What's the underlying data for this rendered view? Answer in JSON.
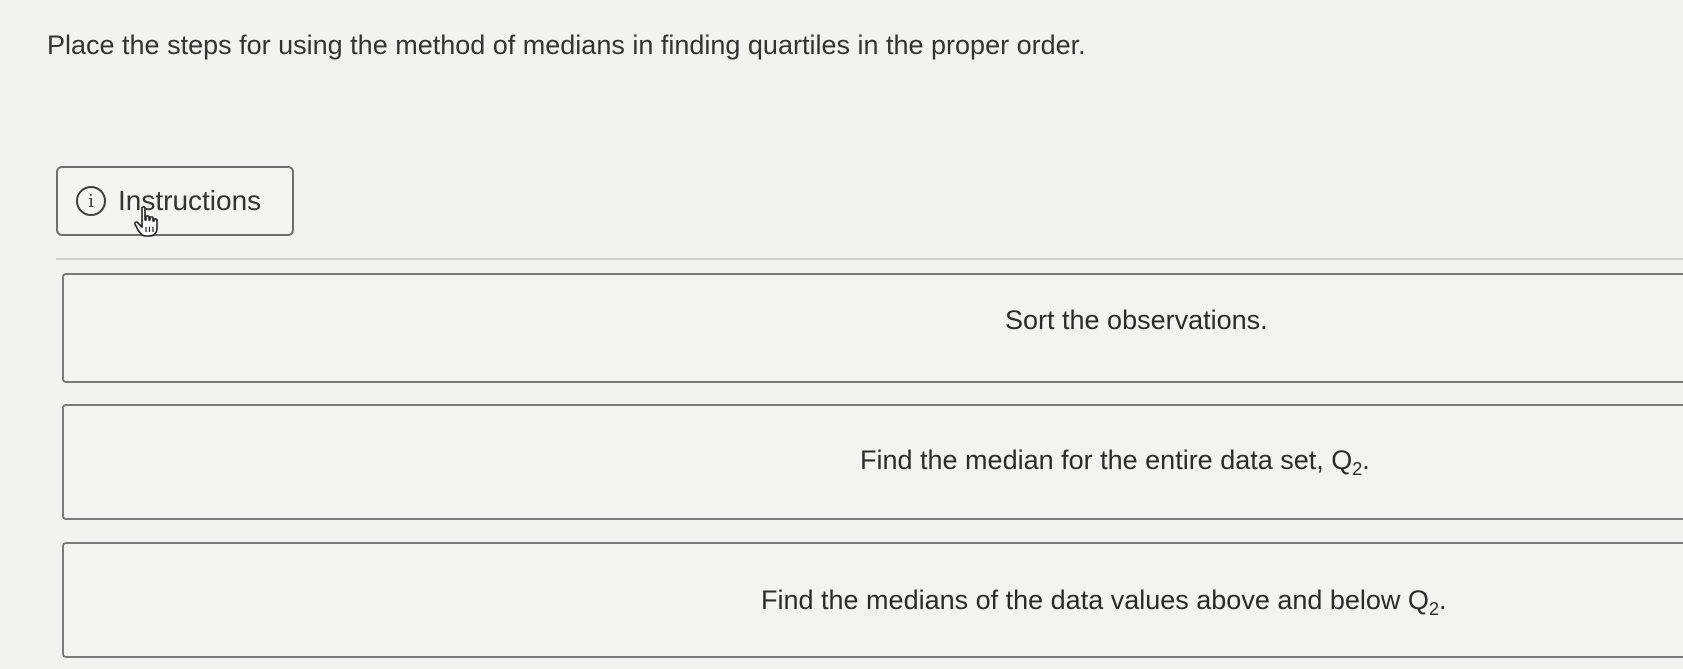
{
  "question": {
    "text": "Place the steps for using the method of medians in finding quartiles in the proper order."
  },
  "instructions_button": {
    "label": "Instructions",
    "icon": "info-icon",
    "icon_glyph": "i"
  },
  "steps": [
    {
      "text": "Sort the observations."
    },
    {
      "text": "Find the median for the entire data set, Q",
      "subscript": "2",
      "suffix": "."
    },
    {
      "text": "Find the medians of the data values above and below Q",
      "subscript": "2",
      "suffix": "."
    }
  ]
}
